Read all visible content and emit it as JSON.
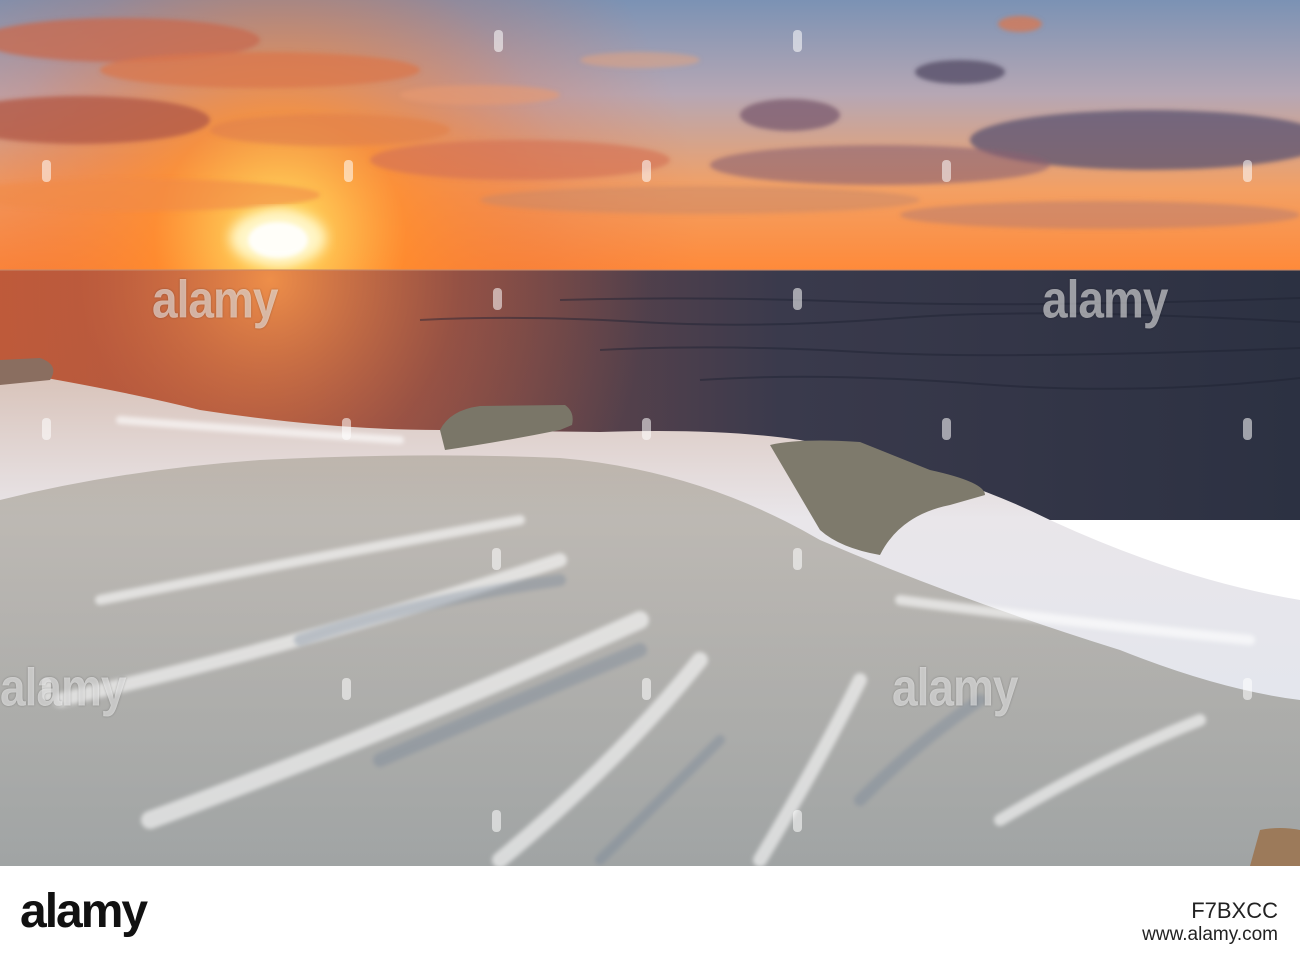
{
  "photo": {
    "scene": "sunrise-over-ocean-rock-platform",
    "colors": {
      "sky_top": "#6f8db3",
      "sky_glow": "#ff8a2a",
      "sun": "#fff6c8",
      "sea_dark": "#2c3142",
      "sea_glow": "#d9643a",
      "foam": "#eef3f8",
      "rock": "#8a8a80"
    }
  },
  "watermark": {
    "text": "alamy"
  },
  "stock_bar": {
    "logo": "alamy",
    "image_id": "F7BXCC",
    "site": "www.alamy.com"
  }
}
